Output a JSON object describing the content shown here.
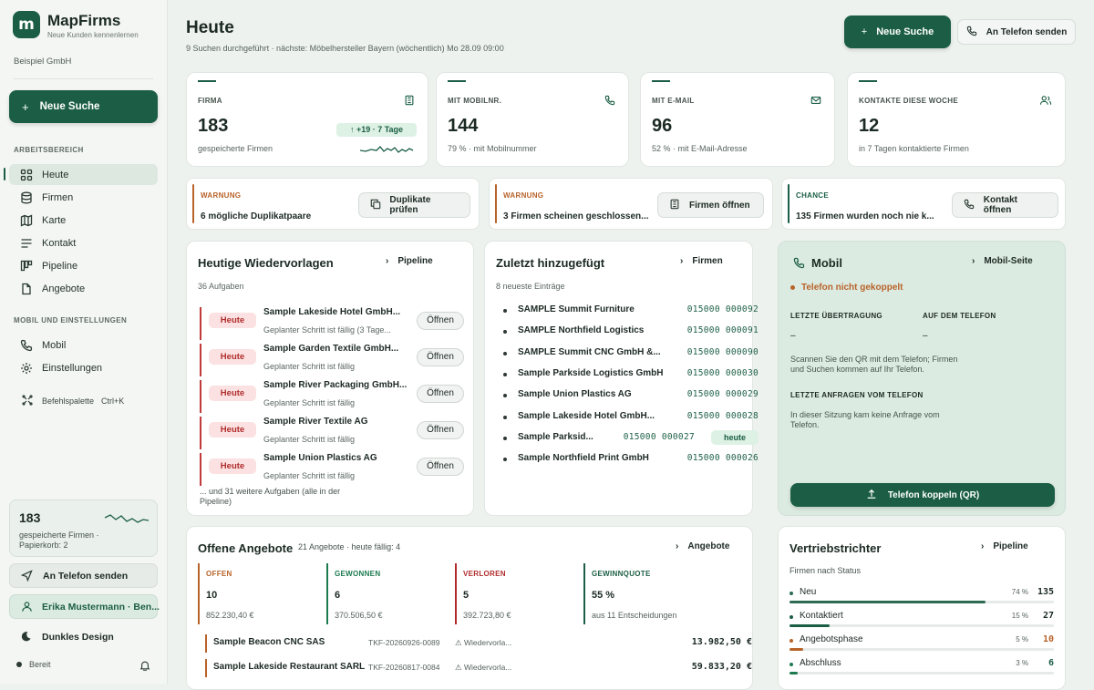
{
  "app": {
    "name": "MapFirms",
    "tagline": "Neue Kunden kennenlernen",
    "logo_letter": "m",
    "org": "Beispiel GmbH",
    "accent": "#1b5e45"
  },
  "sidebar": {
    "new_search": "Neue Suche",
    "section_work": "ARBEITSBEREICH",
    "nav": [
      {
        "label": "Heute",
        "icon": "grid-icon",
        "active": true
      },
      {
        "label": "Firmen",
        "icon": "database-icon"
      },
      {
        "label": "Karte",
        "icon": "map-icon"
      },
      {
        "label": "Kontakt",
        "icon": "list-icon"
      },
      {
        "label": "Pipeline",
        "icon": "kanban-icon"
      },
      {
        "label": "Angebote",
        "icon": "document-icon"
      }
    ],
    "section_mobile": "MOBIL UND EINSTELLUNGEN",
    "nav2": [
      {
        "label": "Mobil",
        "icon": "phone-icon"
      },
      {
        "label": "Einstellungen",
        "icon": "gear-icon"
      }
    ],
    "command_palette": "Befehlspalette",
    "command_shortcut": "Ctrl+K",
    "stat": {
      "value": "183",
      "text": "gespeicherte Firmen · Papierkorb: 2"
    },
    "send_phone": "An Telefon senden",
    "user": "Erika Mustermann · Ben...",
    "dark_mode": "Dunkles Design",
    "status": "Bereit"
  },
  "header": {
    "title": "Heute",
    "subtitle": "9 Suchen durchgeführt · nächste: Möbelhersteller Bayern (wöchentlich) Mo 28.09 09:00",
    "new_search": "Neue Suche",
    "send_phone": "An Telefon senden"
  },
  "kpis": [
    {
      "label": "FIRMA",
      "value": "183",
      "sub": "gespeicherte Firmen",
      "badge": "↑ +19 · 7 Tage",
      "icon": "building-icon"
    },
    {
      "label": "MIT MOBILNR.",
      "value": "144",
      "sub": "79 % · mit Mobilnummer",
      "icon": "phone-icon"
    },
    {
      "label": "MIT E-MAIL",
      "value": "96",
      "sub": "52 % · mit E-Mail-Adresse",
      "icon": "mail-icon"
    },
    {
      "label": "KONTAKTE DIESE WOCHE",
      "value": "12",
      "sub": "in 7 Tagen kontaktierte Firmen",
      "icon": "users-icon"
    }
  ],
  "alerts": [
    {
      "label": "WARNUNG",
      "text": "6 mögliche Duplikatpaare",
      "button": "Duplikate prüfen",
      "color": "#b8632a",
      "icon": "copy-icon"
    },
    {
      "label": "WARNUNG",
      "text": "3 Firmen scheinen geschlossen...",
      "button": "Firmen öffnen",
      "color": "#b8632a",
      "icon": "building-icon"
    },
    {
      "label": "CHANCE",
      "text": "135 Firmen wurden noch nie k...",
      "button": "Kontakt öffnen",
      "color": "#1b5e45",
      "icon": "phone-icon"
    }
  ],
  "followups": {
    "title": "Heutige Wiedervorlagen",
    "link": "Pipeline",
    "count": "36 Aufgaben",
    "items": [
      {
        "tag": "Heute",
        "name": "Sample Lakeside Hotel GmbH...",
        "step": "Geplanter Schritt ist fällig (3 Tage...",
        "button": "Öffnen"
      },
      {
        "tag": "Heute",
        "name": "Sample Garden Textile GmbH...",
        "step": "Geplanter Schritt ist fällig",
        "button": "Öffnen"
      },
      {
        "tag": "Heute",
        "name": "Sample River Packaging GmbH...",
        "step": "Geplanter Schritt ist fällig",
        "button": "Öffnen"
      },
      {
        "tag": "Heute",
        "name": "Sample River Textile AG",
        "step": "Geplanter Schritt ist fällig",
        "button": "Öffnen"
      },
      {
        "tag": "Heute",
        "name": "Sample Union Plastics AG",
        "step": "Geplanter Schritt ist fällig",
        "button": "Öffnen"
      }
    ],
    "more": "... und 31 weitere Aufgaben (alle in der Pipeline)"
  },
  "recent": {
    "title": "Zuletzt hinzugefügt",
    "link": "Firmen",
    "count": "8 neueste Einträge",
    "items": [
      {
        "name": "SAMPLE Summit Furniture",
        "id": "015000 000092"
      },
      {
        "name": "SAMPLE Northfield Logistics",
        "id": "015000 000091"
      },
      {
        "name": "SAMPLE Summit CNC GmbH &...",
        "id": "015000 000090"
      },
      {
        "name": "Sample Parkside Logistics GmbH",
        "id": "015000 000030"
      },
      {
        "name": "Sample Union Plastics AG",
        "id": "015000 000029"
      },
      {
        "name": "Sample Lakeside Hotel GmbH...",
        "id": "015000 000028"
      },
      {
        "name": "Sample Parksid...",
        "id": "015000 000027",
        "badge": "heute"
      },
      {
        "name": "Sample Northfield Print GmbH",
        "id": "015000 000026"
      }
    ]
  },
  "mobile": {
    "title": "Mobil",
    "link": "Mobil-Seite",
    "status": "Telefon nicht gekoppelt",
    "last_transfer_label": "LETZTE ÜBERTRAGUNG",
    "last_transfer": "–",
    "on_phone_label": "AUF DEM TELEFON",
    "on_phone": "–",
    "hint": "Scannen Sie den QR mit dem Telefon; Firmen und Suchen kommen auf Ihr Telefon.",
    "requests_label": "LETZTE ANFRAGEN VOM TELEFON",
    "requests": "In dieser Sitzung kam keine Anfrage vom Telefon.",
    "button": "Telefon koppeln (QR)"
  },
  "offers": {
    "title": "Offene Angebote",
    "summary": "21 Angebote · heute fällig: 4",
    "link": "Angebote",
    "stats": [
      {
        "label": "OFFEN",
        "value": "10",
        "sub": "852.230,40 €",
        "color": "#b8632a"
      },
      {
        "label": "GEWONNEN",
        "value": "6",
        "sub": "370.506,50 €",
        "color": "#1b7a4f"
      },
      {
        "label": "VERLOREN",
        "value": "5",
        "sub": "392.723,80 €",
        "color": "#b02c2c"
      },
      {
        "label": "GEWINNQUOTE",
        "value": "55 %",
        "sub": "aus 11 Entscheidungen",
        "color": "#1b5e45"
      }
    ],
    "rows": [
      {
        "name": "Sample Beacon CNC SAS",
        "ref": "TKF-20260926-0089",
        "status": "Wiedervorla...",
        "amount": "13.982,50 €"
      },
      {
        "name": "Sample Lakeside Restaurant SARL",
        "ref": "TKF-20260817-0084",
        "status": "Wiedervorla...",
        "amount": "59.833,20 €"
      }
    ]
  },
  "funnel": {
    "title": "Vertriebstrichter",
    "link": "Pipeline",
    "sub": "Firmen nach Status",
    "stages": [
      {
        "label": "Neu",
        "pct": "74 %",
        "count": "135",
        "fraction": 0.74,
        "color": "#2c6a52"
      },
      {
        "label": "Kontaktiert",
        "pct": "15 %",
        "count": "27",
        "fraction": 0.15,
        "color": "#1b5e45"
      },
      {
        "label": "Angebotsphase",
        "pct": "5 %",
        "count": "10",
        "fraction": 0.05,
        "color": "#b8632a"
      },
      {
        "label": "Abschluss",
        "pct": "3 %",
        "count": "6",
        "fraction": 0.03,
        "color": "#1b7a4f"
      }
    ]
  }
}
